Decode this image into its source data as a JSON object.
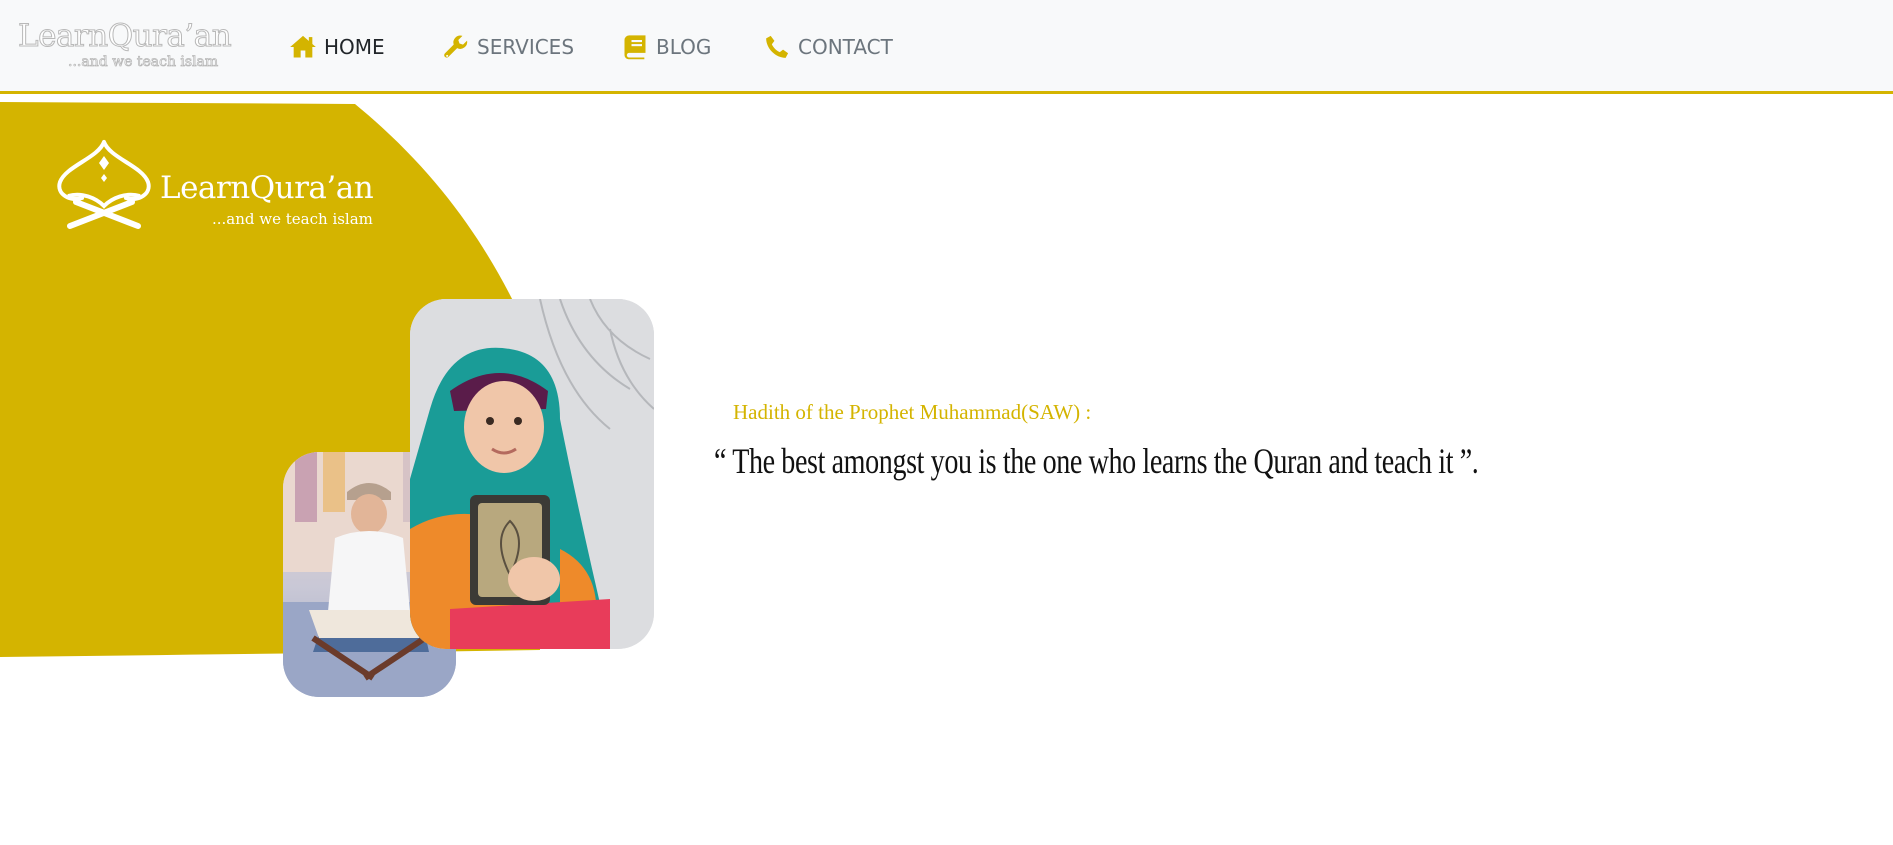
{
  "navbar": {
    "logo": {
      "title": "LearnQura’an",
      "tagline": "...and we teach islam"
    },
    "items": [
      {
        "label": "HOME",
        "icon": "home-icon",
        "active": true
      },
      {
        "label": "SERVICES",
        "icon": "wrench-icon",
        "active": false
      },
      {
        "label": "BLOG",
        "icon": "book-icon",
        "active": false
      },
      {
        "label": "CONTACT",
        "icon": "phone-icon",
        "active": false
      }
    ]
  },
  "hero": {
    "logo": {
      "title": "LearnQura’an",
      "tagline": "...and we teach islam"
    },
    "hadith_label": "Hadith of the Prophet Muhammad(SAW) :",
    "hadith_quote": "“ The best amongst you is the one who learns the Quran and teach it ”."
  },
  "colors": {
    "accent": "#d4b400",
    "navbar_bg": "#f8f9fa",
    "text_dark": "#111111",
    "nav_text": "#6c757d"
  }
}
